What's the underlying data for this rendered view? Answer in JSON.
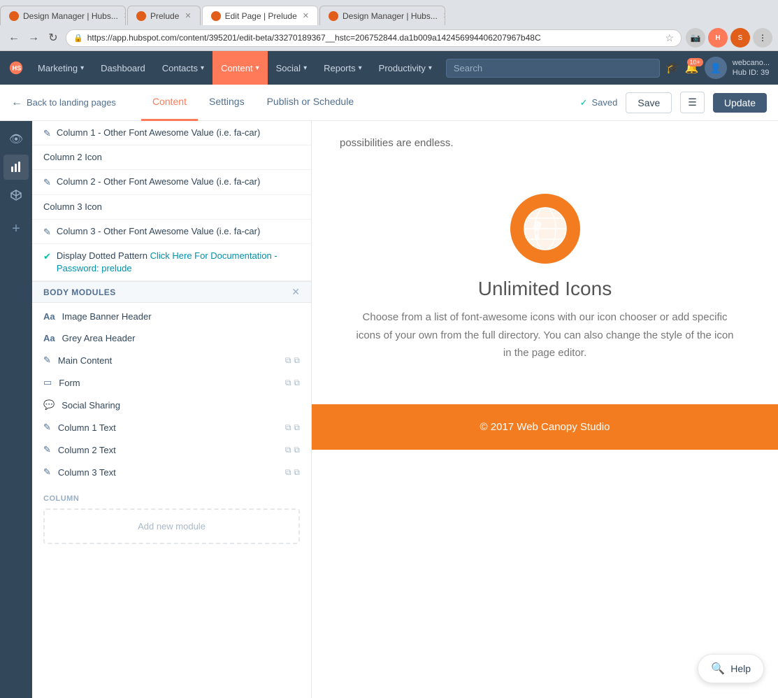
{
  "browser": {
    "tabs": [
      {
        "id": "tab1",
        "label": "Design Manager | Hubs...",
        "active": false,
        "favicon_color": "#e05d1a"
      },
      {
        "id": "tab2",
        "label": "Prelude",
        "active": false,
        "favicon_color": "#e05d1a"
      },
      {
        "id": "tab3",
        "label": "Edit Page | Prelude",
        "active": true,
        "favicon_color": "#e05d1a"
      },
      {
        "id": "tab4",
        "label": "Design Manager | Hubs...",
        "active": false,
        "favicon_color": "#e05d1a"
      }
    ],
    "url": "https://app.hubspot.com/content/395201/edit-beta/33270189367__hstc=206752844.da1b009a142456994406207967b48C",
    "secure_label": "Secure"
  },
  "nav": {
    "logo_label": "HS",
    "items": [
      {
        "id": "marketing",
        "label": "Marketing",
        "has_arrow": true
      },
      {
        "id": "dashboard",
        "label": "Dashboard",
        "has_arrow": false
      },
      {
        "id": "contacts",
        "label": "Contacts",
        "has_arrow": true
      },
      {
        "id": "content",
        "label": "Content",
        "has_arrow": true,
        "active": true
      },
      {
        "id": "social",
        "label": "Social",
        "has_arrow": true
      },
      {
        "id": "reports",
        "label": "Reports",
        "has_arrow": true
      },
      {
        "id": "productivity",
        "label": "Productivity",
        "has_arrow": true
      }
    ],
    "search_placeholder": "Search",
    "notification_count": "10+",
    "user_name": "webcano...",
    "hub_id": "Hub ID: 39"
  },
  "editor_toolbar": {
    "back_label": "Back to landing pages",
    "tabs": [
      {
        "id": "content",
        "label": "Content",
        "active": true
      },
      {
        "id": "settings",
        "label": "Settings",
        "active": false
      },
      {
        "id": "publish",
        "label": "Publish or Schedule",
        "active": false
      }
    ],
    "saved_label": "Saved",
    "save_button": "Save",
    "update_button": "Update"
  },
  "left_sidebar": {
    "icons": [
      {
        "id": "eye",
        "symbol": "👁",
        "label": "eye-icon"
      },
      {
        "id": "chart",
        "symbol": "📊",
        "label": "chart-icon"
      },
      {
        "id": "box",
        "symbol": "⬡",
        "label": "box-icon"
      },
      {
        "id": "add",
        "symbol": "+",
        "label": "add-icon"
      }
    ]
  },
  "content_panel": {
    "scroll_buttons": {
      "up": "▲",
      "down": "▼"
    },
    "items": [
      {
        "id": "col1-icon",
        "type": "edit",
        "icon": "✎",
        "text": "Column 1 - Other Font Awesome Value (i.e. fa-car)"
      },
      {
        "id": "col2-icon-label",
        "type": "label",
        "icon": "",
        "text": "Column 2 Icon"
      },
      {
        "id": "col2-icon",
        "type": "edit",
        "icon": "✎",
        "text": "Column 2 - Other Font Awesome Value (i.e. fa-car)"
      },
      {
        "id": "col3-icon-label",
        "type": "label",
        "icon": "",
        "text": "Column 3 Icon"
      },
      {
        "id": "col3-icon",
        "type": "edit",
        "icon": "✎",
        "text": "Column 3 - Other Font Awesome Value (i.e. fa-car)"
      },
      {
        "id": "display-dotted",
        "type": "checkbox",
        "icon": "✔",
        "text": "Display Dotted Pattern <a href=\"http://www.webcanopystudio.com/prelude-documentation\" target=\"_blank\">Click Here For Documentation - Password: prelude</a>"
      }
    ],
    "body_modules_section": {
      "title": "BODY MODULES",
      "close_icon": "✕",
      "modules": [
        {
          "id": "image-banner-header",
          "icon": "Aa",
          "label": "Image Banner Header",
          "has_actions": false
        },
        {
          "id": "grey-area-header",
          "icon": "Aa",
          "label": "Grey Area Header",
          "has_actions": false
        },
        {
          "id": "main-content",
          "icon": "✎",
          "label": "Main Content",
          "has_actions": true
        },
        {
          "id": "form",
          "icon": "▭",
          "label": "Form",
          "has_actions": true
        },
        {
          "id": "social-sharing",
          "icon": "💬",
          "label": "Social Sharing",
          "has_actions": false
        },
        {
          "id": "column-1-text",
          "icon": "✎",
          "label": "Column 1 Text",
          "has_actions": true
        },
        {
          "id": "column-2-text",
          "icon": "✎",
          "label": "Column 2 Text",
          "has_actions": true
        },
        {
          "id": "column-3-text",
          "icon": "✎",
          "label": "Column 3 Text",
          "has_actions": true
        }
      ]
    },
    "column_section": {
      "title": "COLUMN",
      "add_module_label": "Add new module"
    }
  },
  "preview": {
    "intro_text": "possibilities are endless.",
    "globe_icon_label": "globe-icon",
    "section_title": "Unlimited Icons",
    "section_desc": "Choose from a list of font-awesome icons with our icon chooser or add specific icons of your own from the full directory. You can also change the style of the icon in the page editor.",
    "footer_text": "© 2017 Web Canopy Studio"
  },
  "help_button": {
    "label": "Help",
    "icon": "🔍"
  }
}
